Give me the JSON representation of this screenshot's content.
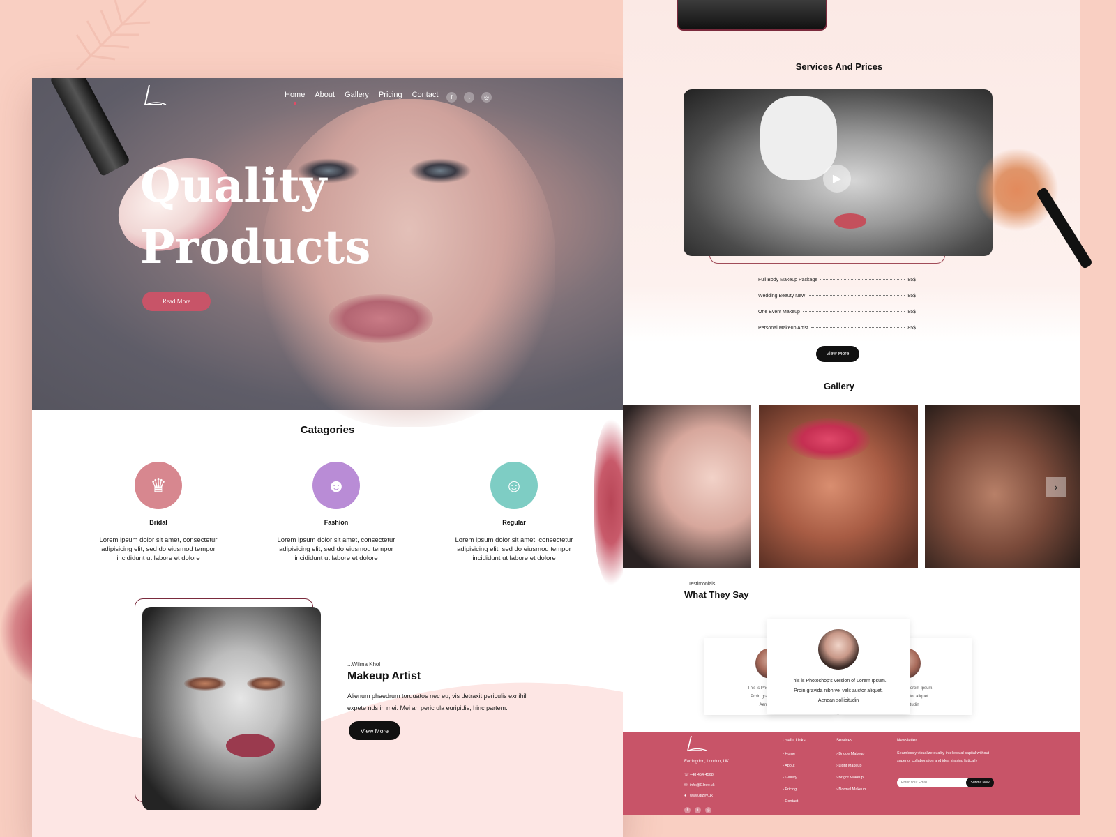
{
  "colors": {
    "accent": "#c85468",
    "dark": "#111111",
    "page_bg": "#f9cfc2"
  },
  "hero": {
    "nav": [
      "Home",
      "About",
      "Gallery",
      "Pricing",
      "Contact"
    ],
    "social_icons": [
      "facebook-icon",
      "twitter-icon",
      "instagram-icon"
    ],
    "title_line1": "Quality",
    "title_line2": "Products",
    "read_more": "Read More"
  },
  "categories": {
    "title": "Catagories",
    "items": [
      {
        "name": "Bridal",
        "icon": "bride-icon",
        "color": "#d7878f",
        "desc": "Lorem ipsum dolor sit amet, consectetur adipisicing elit, sed do eiusmod tempor incididunt ut labore et dolore"
      },
      {
        "name": "Fashion",
        "icon": "fashion-model-icon",
        "color": "#b98cd6",
        "desc": "Lorem ipsum dolor sit amet, consectetur adipisicing elit, sed do eiusmod tempor incididunt ut labore et dolore"
      },
      {
        "name": "Regular",
        "icon": "woman-icon",
        "color": "#7ecdc4",
        "desc": "Lorem ipsum dolor sit amet, consectetur adipisicing elit, sed do eiusmod tempor incididunt ut labore et dolore"
      }
    ]
  },
  "about": {
    "subtitle": "...Wilma Khol",
    "title": "Makeup Artist",
    "text": "Alienum phaedrum torquatos nec eu, vis detraxit periculis exnihil expete nds in mei. Mei an peric ula euripidis, hinc partem.",
    "button": "View More"
  },
  "services": {
    "title": "Services And Prices",
    "items": [
      {
        "name": "Full Body Makeup Package",
        "price": "85$"
      },
      {
        "name": "Wedding Beauty New",
        "price": "85$"
      },
      {
        "name": "One Event Makeup",
        "price": "85$"
      },
      {
        "name": "Personal Makeup Artist",
        "price": "85$"
      }
    ],
    "button": "View More"
  },
  "gallery": {
    "title": "Gallery",
    "next_icon": "chevron-right-icon"
  },
  "testimonials": {
    "subtitle": "...Testimonials",
    "title": "What They Say",
    "main_text_1": "This is Photoshop's version of Lorem Ipsum.",
    "main_text_2": "Proin gravida nibh vel velit auctor aliquet.",
    "main_text_3": "Aenean sollicitudin",
    "side_left_1": "This is Photoshop's versi",
    "side_left_2": "Proin gravida nibh vel",
    "side_left_3": "Aenean solli",
    "side_right_1": "hop's version of Lorem Ipsum.",
    "side_right_2": "ibh vel velit auctor aliquet.",
    "side_right_3": "ean sollicitudin"
  },
  "footer": {
    "address": "Farringdon, London, UK",
    "phone": "+48 454 4568",
    "email": "info@Glzev.uk",
    "web": "www.glzev.uk",
    "useful_title": "Useful Links",
    "useful": [
      "Home",
      "About",
      "Gallery",
      "Pricing",
      "Contact"
    ],
    "services_title": "Services",
    "services": [
      "Bridge Makeup",
      "Light Makeup",
      "Bright Makeup",
      "Normal Makeup"
    ],
    "newsletter_title": "Newsletter",
    "newsletter_text": "Seamlessly visualize quality intellectual capital without superior collaboration and idea sharing listically",
    "email_placeholder": "Enter Your Email",
    "submit": "Submit Now"
  }
}
